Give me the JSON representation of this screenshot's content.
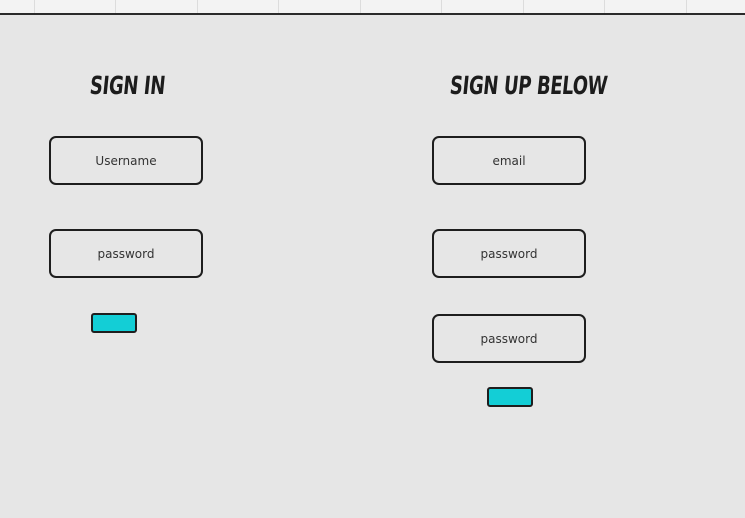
{
  "signin": {
    "title": "SIGN IN",
    "username_placeholder": "Username",
    "password_placeholder": "password",
    "submit_label": ""
  },
  "signup": {
    "title": "SIGN UP BELOW",
    "email_placeholder": "email",
    "password_placeholder": "password",
    "confirm_password_placeholder": "password",
    "submit_label": ""
  },
  "colors": {
    "background": "#e6e6e6",
    "button_fill": "#13ced6",
    "outline": "#1e1e1e"
  }
}
